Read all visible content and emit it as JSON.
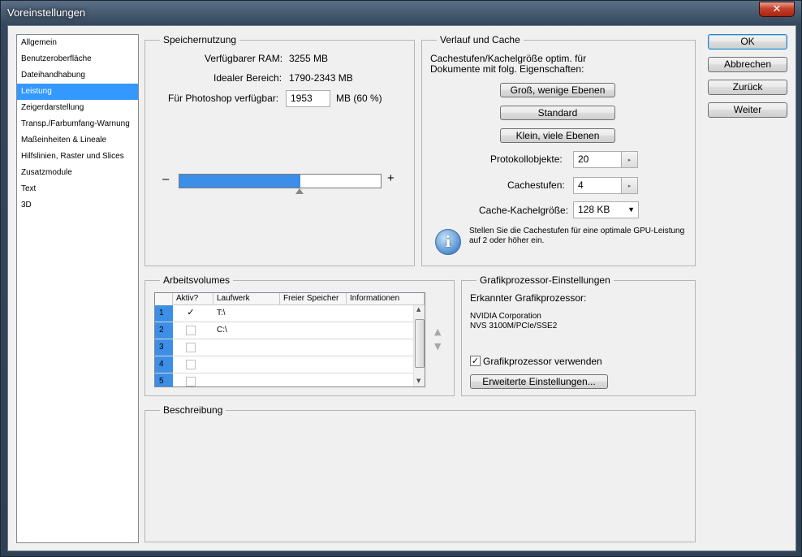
{
  "window": {
    "title": "Voreinstellungen",
    "close_icon": "close-icon"
  },
  "nav": {
    "items": [
      {
        "label": "Allgemein",
        "selected": false
      },
      {
        "label": "Benutzeroberfläche",
        "selected": false
      },
      {
        "label": "Dateihandhabung",
        "selected": false
      },
      {
        "label": "Leistung",
        "selected": true
      },
      {
        "label": "Zeigerdarstellung",
        "selected": false
      },
      {
        "label": "Transp./Farbumfang-Warnung",
        "selected": false
      },
      {
        "label": "Maßeinheiten & Lineale",
        "selected": false
      },
      {
        "label": "Hilfslinien, Raster und Slices",
        "selected": false
      },
      {
        "label": "Zusatzmodule",
        "selected": false
      },
      {
        "label": "Text",
        "selected": false
      },
      {
        "label": "3D",
        "selected": false
      }
    ]
  },
  "memory": {
    "legend": "Speichernutzung",
    "ram_label": "Verfügbarer RAM:",
    "ram_value": "3255 MB",
    "ideal_label": "Idealer Bereich:",
    "ideal_value": "1790-2343 MB",
    "ps_label": "Für Photoshop verfügbar:",
    "ps_value": "1953",
    "ps_unit": "MB (60 %)",
    "slider_minus": "–",
    "slider_plus": "+",
    "slider_fraction": 0.6
  },
  "cache": {
    "legend": "Verlauf und Cache",
    "desc_line1": "Cachestufen/Kachelgröße optim. für",
    "desc_line2": "Dokumente mit folg. Eigenschaften:",
    "btn_large": "Groß, wenige Ebenen",
    "btn_standard": "Standard",
    "btn_small": "Klein, viele Ebenen",
    "history_label": "Protokollobjekte:",
    "history_value": "20",
    "levels_label": "Cachestufen:",
    "levels_value": "4",
    "tile_label": "Cache-Kachelgröße:",
    "tile_value": "128 KB",
    "info_line1": "Stellen Sie die Cachestufen für eine optimale GPU-Leistung",
    "info_line2": "auf 2 oder höher ein."
  },
  "scratch": {
    "legend": "Arbeitsvolumes",
    "columns": [
      "Aktiv?",
      "Laufwerk",
      "Freier Speicher",
      "Informationen"
    ],
    "rows": [
      {
        "num": "1",
        "active": true,
        "drive": "T:\\"
      },
      {
        "num": "2",
        "active": false,
        "drive": "C:\\"
      },
      {
        "num": "3",
        "active": false,
        "drive": ""
      },
      {
        "num": "4",
        "active": false,
        "drive": ""
      },
      {
        "num": "5",
        "active": false,
        "drive": ""
      }
    ]
  },
  "gpu": {
    "legend": "Grafikprozessor-Einstellungen",
    "detected_label": "Erkannter Grafikprozessor:",
    "vendor": "NVIDIA Corporation",
    "model": "NVS 3100M/PCIe/SSE2",
    "use_label": "Grafikprozessor verwenden",
    "use_checked": true,
    "advanced_btn": "Erweiterte Einstellungen..."
  },
  "description": {
    "legend": "Beschreibung"
  },
  "buttons": {
    "ok": "OK",
    "cancel": "Abbrechen",
    "back": "Zurück",
    "next": "Weiter"
  }
}
